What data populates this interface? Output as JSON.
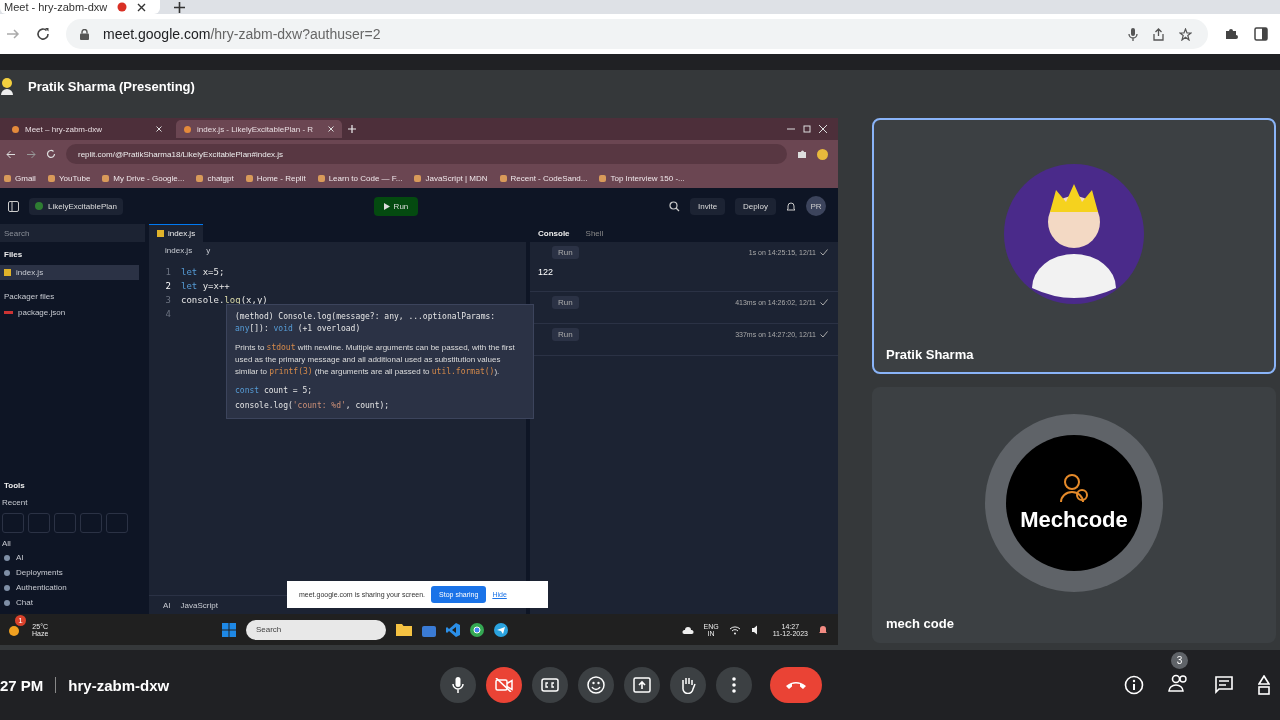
{
  "browser": {
    "tabs": [
      {
        "title": "Meet - hry-zabm-dxw",
        "selected": true,
        "recording": true
      }
    ],
    "url_host": "meet.google.com",
    "url_path": "/hry-zabm-dxw?authuser=2"
  },
  "presenter": {
    "label": "Pratik Sharma (Presenting)"
  },
  "shared_screen": {
    "tabs": [
      {
        "title": "Meet – hry-zabm-dxw",
        "selected": false
      },
      {
        "title": "index.js - LikelyExcitablePlan - R",
        "selected": true
      }
    ],
    "url": "replit.com/@PratikSharma18/LikelyExcitablePlan#index.js",
    "bookmarks": [
      "Gmail",
      "YouTube",
      "My Drive - Google...",
      "chatgpt",
      "Home - Replit",
      "Learn to Code — F...",
      "JavaScript | MDN",
      "Recent - CodeSand...",
      "Top Interview 150 -..."
    ],
    "repl_name": "LikelyExcitablePlan",
    "run_label": "Run",
    "invite_label": "Invite",
    "deploy_label": "Deploy",
    "user_initials": "PR",
    "sidebar": {
      "search_placeholder": "Search",
      "files_heading": "Files",
      "files": [
        {
          "name": "index.js",
          "selected": true
        }
      ],
      "packager_heading": "Packager files",
      "packager_files": [
        "package.json"
      ],
      "tools_heading": "Tools",
      "recent_label": "Recent",
      "all_label": "All",
      "tools": [
        "AI",
        "Deployments",
        "Authentication",
        "Chat"
      ]
    },
    "editor": {
      "tab": "index.js",
      "breadcrumb": [
        "index.js",
        "y"
      ],
      "lines": [
        {
          "number": "1",
          "current": false,
          "tokens": [
            {
              "text": "let",
              "kind": "keyword"
            },
            {
              "text": " x=5;",
              "kind": "plain"
            }
          ]
        },
        {
          "number": "2",
          "current": true,
          "tokens": [
            {
              "text": "let",
              "kind": "keyword"
            },
            {
              "text": " y=x++",
              "kind": "plain"
            }
          ]
        },
        {
          "number": "3",
          "current": false,
          "tokens": [
            {
              "text": "console.",
              "kind": "plain"
            },
            {
              "text": "log",
              "kind": "function"
            },
            {
              "text": "(x,y)",
              "kind": "plain"
            }
          ]
        },
        {
          "number": "4",
          "current": false
        }
      ],
      "status": [
        "AI",
        "JavaScript"
      ]
    },
    "hover": {
      "signature": [
        {
          "text": "(method) Console.log(message?: any, ...optionalParams: ",
          "kind": "plain"
        },
        {
          "text": "any",
          "kind": "keyword"
        },
        {
          "text": "[]): ",
          "kind": "plain"
        },
        {
          "text": "void",
          "kind": "keyword"
        },
        {
          "text": " (+1 overload)",
          "kind": "plain"
        }
      ],
      "description": [
        {
          "text": "Prints to ",
          "kind": "text"
        },
        {
          "text": "stdout",
          "kind": "code"
        },
        {
          "text": " with newline. Multiple arguments can be passed, with the first used as the primary message and all additional used as substitution values similar to ",
          "kind": "text"
        },
        {
          "text": "printf(3)",
          "kind": "code"
        },
        {
          "text": " (the arguments are all passed to ",
          "kind": "text"
        },
        {
          "text": "util.format()",
          "kind": "code"
        },
        {
          "text": ").",
          "kind": "text"
        }
      ],
      "example": [
        [
          {
            "text": "const",
            "kind": "keyword"
          },
          {
            "text": " count = 5;",
            "kind": "plain"
          }
        ],
        [
          {
            "text": "console.log(",
            "kind": "plain"
          },
          {
            "text": "'count: %d'",
            "kind": "string"
          },
          {
            "text": ", count);",
            "kind": "plain"
          }
        ]
      ]
    },
    "console": {
      "tabs": [
        {
          "label": "Console",
          "selected": true
        },
        {
          "label": "Shell",
          "selected": false
        }
      ],
      "runs": [
        {
          "label": "Run",
          "output": "122",
          "time": "1s on 14:25:15, 12/11",
          "success": true
        },
        {
          "label": "Run",
          "time": "413ms on 14:26:02, 12/11",
          "success": true
        },
        {
          "label": "Run",
          "time": "337ms on 14:27:20, 12/11",
          "success": true
        }
      ]
    },
    "share_banner": {
      "text": "meet.google.com is sharing your screen.",
      "stop_label": "Stop sharing",
      "hide_label": "Hide"
    },
    "taskbar": {
      "temperature": "25°C",
      "weather": "Haze",
      "weather_badge": "1",
      "search_placeholder": "Search",
      "language": "ENG",
      "region": "IN",
      "time": "14:27",
      "date": "11-12-2023"
    }
  },
  "tiles": [
    {
      "name": "Pratik Sharma",
      "highlighted": true,
      "kind": "avatar"
    },
    {
      "name": "mech code",
      "highlighted": false,
      "kind": "logo",
      "logo_text": "Mechcode"
    }
  ],
  "bottom_bar": {
    "time": "27 PM",
    "meeting_code": "hry-zabm-dxw",
    "mic_on": true,
    "camera_on": false,
    "participants_count": "3"
  }
}
